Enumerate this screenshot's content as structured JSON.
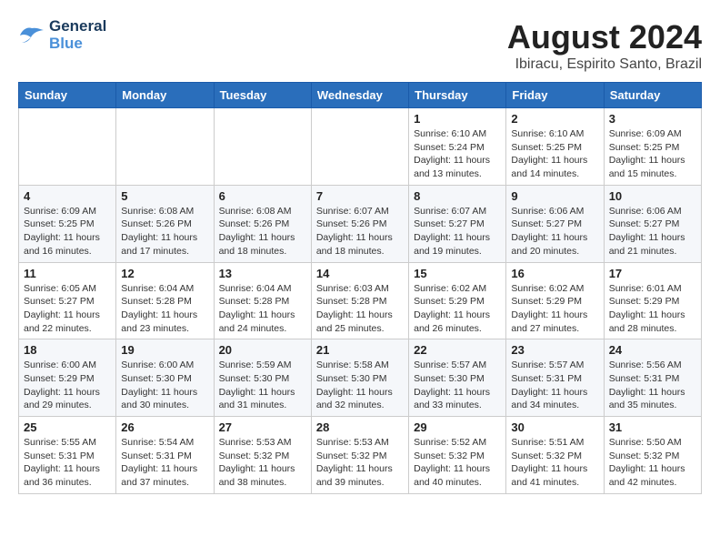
{
  "logo": {
    "line1": "General",
    "line2": "Blue"
  },
  "title": "August 2024",
  "location": "Ibiracu, Espirito Santo, Brazil",
  "weekdays": [
    "Sunday",
    "Monday",
    "Tuesday",
    "Wednesday",
    "Thursday",
    "Friday",
    "Saturday"
  ],
  "weeks": [
    [
      {
        "day": "",
        "info": ""
      },
      {
        "day": "",
        "info": ""
      },
      {
        "day": "",
        "info": ""
      },
      {
        "day": "",
        "info": ""
      },
      {
        "day": "1",
        "info": "Sunrise: 6:10 AM\nSunset: 5:24 PM\nDaylight: 11 hours\nand 13 minutes."
      },
      {
        "day": "2",
        "info": "Sunrise: 6:10 AM\nSunset: 5:25 PM\nDaylight: 11 hours\nand 14 minutes."
      },
      {
        "day": "3",
        "info": "Sunrise: 6:09 AM\nSunset: 5:25 PM\nDaylight: 11 hours\nand 15 minutes."
      }
    ],
    [
      {
        "day": "4",
        "info": "Sunrise: 6:09 AM\nSunset: 5:25 PM\nDaylight: 11 hours\nand 16 minutes."
      },
      {
        "day": "5",
        "info": "Sunrise: 6:08 AM\nSunset: 5:26 PM\nDaylight: 11 hours\nand 17 minutes."
      },
      {
        "day": "6",
        "info": "Sunrise: 6:08 AM\nSunset: 5:26 PM\nDaylight: 11 hours\nand 18 minutes."
      },
      {
        "day": "7",
        "info": "Sunrise: 6:07 AM\nSunset: 5:26 PM\nDaylight: 11 hours\nand 18 minutes."
      },
      {
        "day": "8",
        "info": "Sunrise: 6:07 AM\nSunset: 5:27 PM\nDaylight: 11 hours\nand 19 minutes."
      },
      {
        "day": "9",
        "info": "Sunrise: 6:06 AM\nSunset: 5:27 PM\nDaylight: 11 hours\nand 20 minutes."
      },
      {
        "day": "10",
        "info": "Sunrise: 6:06 AM\nSunset: 5:27 PM\nDaylight: 11 hours\nand 21 minutes."
      }
    ],
    [
      {
        "day": "11",
        "info": "Sunrise: 6:05 AM\nSunset: 5:27 PM\nDaylight: 11 hours\nand 22 minutes."
      },
      {
        "day": "12",
        "info": "Sunrise: 6:04 AM\nSunset: 5:28 PM\nDaylight: 11 hours\nand 23 minutes."
      },
      {
        "day": "13",
        "info": "Sunrise: 6:04 AM\nSunset: 5:28 PM\nDaylight: 11 hours\nand 24 minutes."
      },
      {
        "day": "14",
        "info": "Sunrise: 6:03 AM\nSunset: 5:28 PM\nDaylight: 11 hours\nand 25 minutes."
      },
      {
        "day": "15",
        "info": "Sunrise: 6:02 AM\nSunset: 5:29 PM\nDaylight: 11 hours\nand 26 minutes."
      },
      {
        "day": "16",
        "info": "Sunrise: 6:02 AM\nSunset: 5:29 PM\nDaylight: 11 hours\nand 27 minutes."
      },
      {
        "day": "17",
        "info": "Sunrise: 6:01 AM\nSunset: 5:29 PM\nDaylight: 11 hours\nand 28 minutes."
      }
    ],
    [
      {
        "day": "18",
        "info": "Sunrise: 6:00 AM\nSunset: 5:29 PM\nDaylight: 11 hours\nand 29 minutes."
      },
      {
        "day": "19",
        "info": "Sunrise: 6:00 AM\nSunset: 5:30 PM\nDaylight: 11 hours\nand 30 minutes."
      },
      {
        "day": "20",
        "info": "Sunrise: 5:59 AM\nSunset: 5:30 PM\nDaylight: 11 hours\nand 31 minutes."
      },
      {
        "day": "21",
        "info": "Sunrise: 5:58 AM\nSunset: 5:30 PM\nDaylight: 11 hours\nand 32 minutes."
      },
      {
        "day": "22",
        "info": "Sunrise: 5:57 AM\nSunset: 5:30 PM\nDaylight: 11 hours\nand 33 minutes."
      },
      {
        "day": "23",
        "info": "Sunrise: 5:57 AM\nSunset: 5:31 PM\nDaylight: 11 hours\nand 34 minutes."
      },
      {
        "day": "24",
        "info": "Sunrise: 5:56 AM\nSunset: 5:31 PM\nDaylight: 11 hours\nand 35 minutes."
      }
    ],
    [
      {
        "day": "25",
        "info": "Sunrise: 5:55 AM\nSunset: 5:31 PM\nDaylight: 11 hours\nand 36 minutes."
      },
      {
        "day": "26",
        "info": "Sunrise: 5:54 AM\nSunset: 5:31 PM\nDaylight: 11 hours\nand 37 minutes."
      },
      {
        "day": "27",
        "info": "Sunrise: 5:53 AM\nSunset: 5:32 PM\nDaylight: 11 hours\nand 38 minutes."
      },
      {
        "day": "28",
        "info": "Sunrise: 5:53 AM\nSunset: 5:32 PM\nDaylight: 11 hours\nand 39 minutes."
      },
      {
        "day": "29",
        "info": "Sunrise: 5:52 AM\nSunset: 5:32 PM\nDaylight: 11 hours\nand 40 minutes."
      },
      {
        "day": "30",
        "info": "Sunrise: 5:51 AM\nSunset: 5:32 PM\nDaylight: 11 hours\nand 41 minutes."
      },
      {
        "day": "31",
        "info": "Sunrise: 5:50 AM\nSunset: 5:32 PM\nDaylight: 11 hours\nand 42 minutes."
      }
    ]
  ]
}
